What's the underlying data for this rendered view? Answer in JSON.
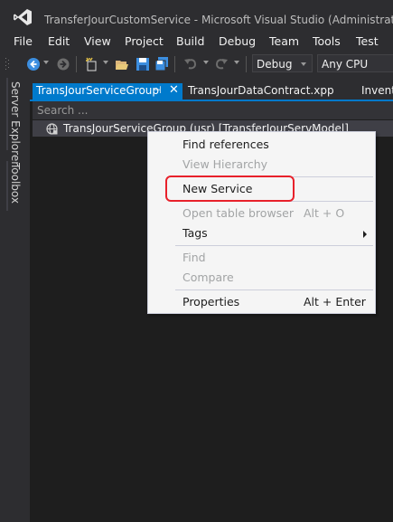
{
  "window": {
    "title": "TransferJourCustomService - Microsoft Visual Studio  (Administrator)"
  },
  "menu": {
    "items": [
      "File",
      "Edit",
      "View",
      "Project",
      "Build",
      "Debug",
      "Team",
      "Tools",
      "Test"
    ]
  },
  "toolbar": {
    "configuration": "Debug",
    "platform": "Any CPU"
  },
  "side_panels": {
    "server_explorer": "Server Explorer",
    "toolbox": "Toolbox"
  },
  "tabs": {
    "active": "TransJourServiceGroup",
    "pin_glyph": "⊣",
    "close_glyph": "✕",
    "second": "TransJourDataContract.xpp",
    "third": "InventL"
  },
  "search": {
    "placeholder": "Search ..."
  },
  "tree": {
    "node_label": "TransJourServiceGroup (usr) [TransferJourServModel]"
  },
  "context_menu": {
    "find_references": "Find references",
    "view_hierarchy": "View Hierarchy",
    "new_service": "New Service",
    "open_table_browser": "Open table browser",
    "open_table_browser_shortcut": "Alt + O",
    "tags": "Tags",
    "find": "Find",
    "compare": "Compare",
    "properties": "Properties",
    "properties_shortcut": "Alt + Enter"
  },
  "colors": {
    "accent": "#007acc",
    "highlight": "#e8212b",
    "background": "#1e1e1e",
    "chrome": "#2d2d30"
  }
}
